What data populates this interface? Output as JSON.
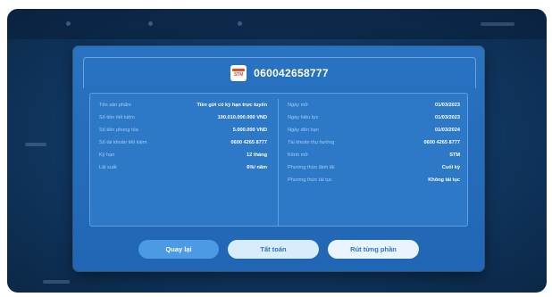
{
  "dialog": {
    "account_number": "060042658777",
    "badge_text": "STM"
  },
  "left_rows": [
    {
      "label": "Tên sản phẩm",
      "value": "Tiền gửi có kỳ hạn trực tuyến"
    },
    {
      "label": "Số tiền tiết kiệm",
      "value": "100.010.000.000 VND"
    },
    {
      "label": "Số tiền phong tỏa",
      "value": "5.000.000 VND"
    },
    {
      "label": "Số tài khoản tiết kiệm",
      "value": "0600 4265 8777"
    },
    {
      "label": "Kỳ hạn",
      "value": "12 tháng"
    },
    {
      "label": "Lãi suất",
      "value": "6%/ năm"
    }
  ],
  "right_rows": [
    {
      "label": "Ngày mở",
      "value": "01/03/2023"
    },
    {
      "label": "Ngày hiệu lực",
      "value": "01/03/2023"
    },
    {
      "label": "Ngày đến hạn",
      "value": "01/03/2024"
    },
    {
      "label": "Tài khoản thụ hưởng",
      "value": "0600 4265 8777"
    },
    {
      "label": "Kênh mở",
      "value": "STM"
    },
    {
      "label": "Phương thức lãnh lãi",
      "value": "Cuối kỳ"
    },
    {
      "label": "Phương thức tái tục",
      "value": "Không tái tục"
    }
  ],
  "buttons": {
    "back": "Quay lại",
    "settle": "Tất toán",
    "partial_withdraw": "Rút từng phần"
  },
  "colors": {
    "dialog": "#2066b4",
    "primary_button": "#4d9ae4",
    "light_button": "#d9ecfc"
  }
}
